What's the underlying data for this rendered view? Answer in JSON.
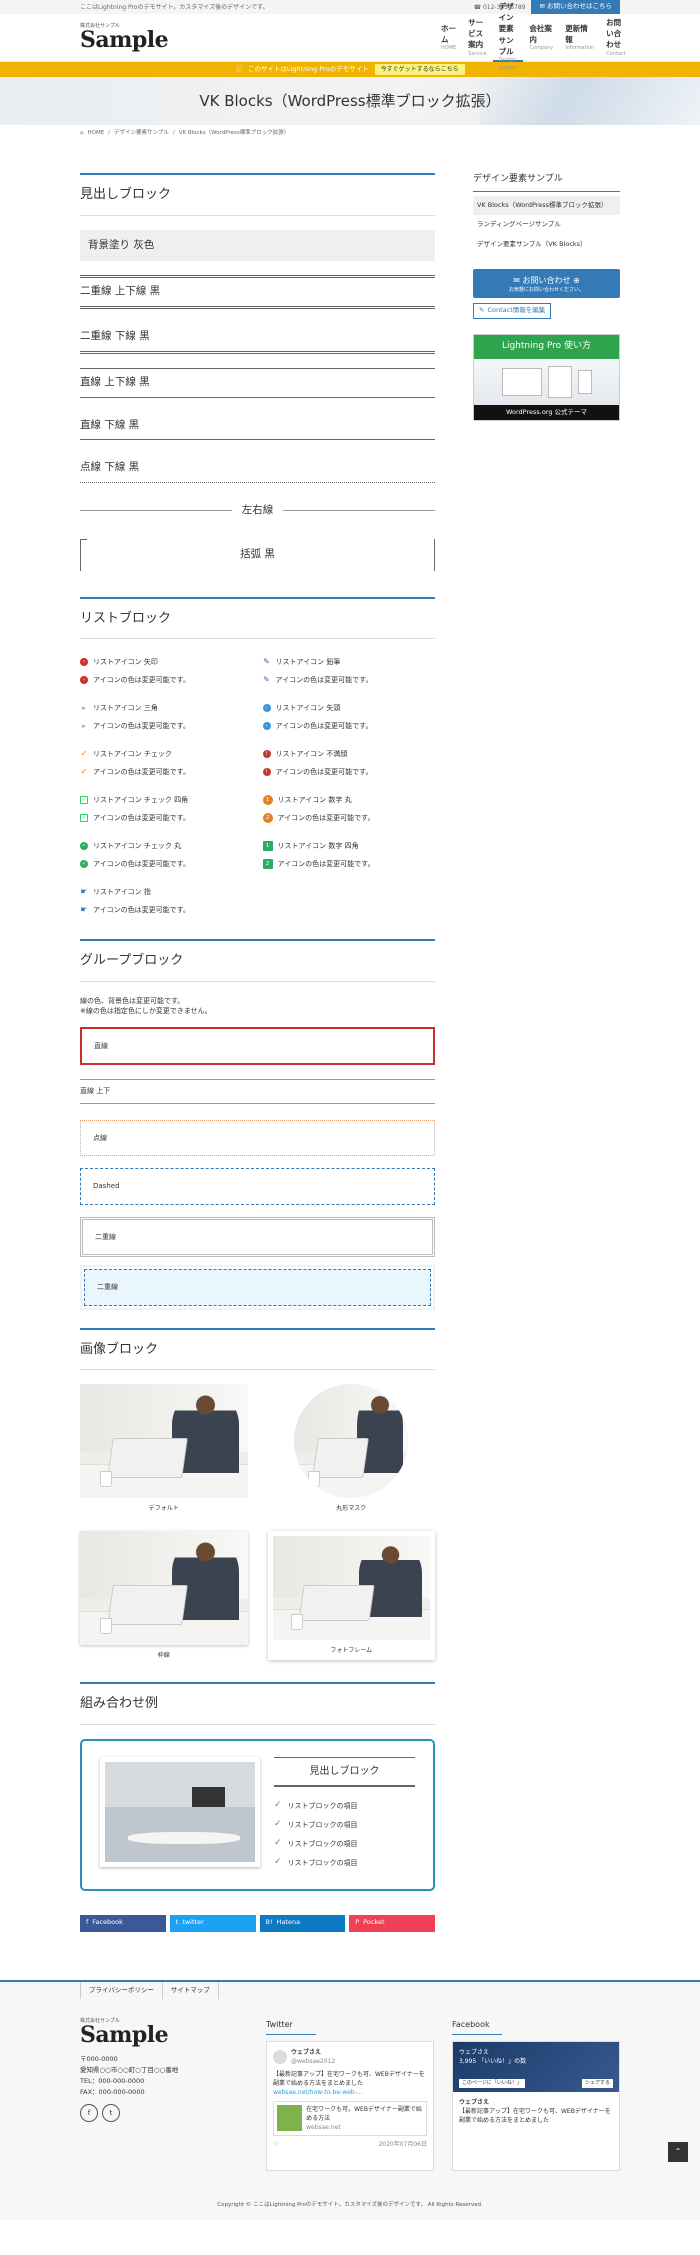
{
  "topbar": {
    "tagline": "ここはLightning Proのデモサイト。カスタマイズ後のデザインです。",
    "phone": "☎ 012-345-6789",
    "contact": "✉ お問い合わせはこちら"
  },
  "header": {
    "logo_sub": "株式会社サンプル",
    "logo_main": "Sample",
    "nav": [
      {
        "label": "ホーム",
        "en": "HOME"
      },
      {
        "label": "サービス案内",
        "en": "Service"
      },
      {
        "label": "デザイン要素サンプル",
        "en": "Design Sample"
      },
      {
        "label": "会社案内",
        "en": "Company"
      },
      {
        "label": "更新情報",
        "en": "Information"
      },
      {
        "label": "お問い合わせ",
        "en": "Contact"
      }
    ]
  },
  "notice": {
    "text": "このサイトはLightning Proのデモサイト",
    "button": "今すぐゲットするならこちら"
  },
  "page_title": "VK Blocks（WordPress標準ブロック拡張）",
  "breadcrumb": {
    "home": "HOME",
    "parent": "デザイン要素サンプル",
    "current": "VK Blocks（WordPress標準ブロック拡張）"
  },
  "headings": {
    "title": "見出しブロック",
    "items": [
      "背景塗り 灰色",
      "二重線 上下線 黒",
      "二重線 下線 黒",
      "直線 上下線 黒",
      "直線 下線 黒",
      "点線 下線 黒",
      "左右線",
      "括弧 黒"
    ]
  },
  "list_block": {
    "title": "リストブロック",
    "note": "アイコンの色は変更可能です。",
    "left": [
      {
        "label": "リストアイコン 矢印",
        "icon": "arrow-circle-icon",
        "color": "#c9302c",
        "glyph": "›"
      },
      {
        "label": "リストアイコン 三角",
        "icon": "triangle-icon",
        "color": "#999999",
        "glyph": "▸"
      },
      {
        "label": "リストアイコン チェック",
        "icon": "check-icon",
        "color": "#e67e22",
        "glyph": "✓"
      },
      {
        "label": "リストアイコン チェック 四角",
        "icon": "check-square-icon",
        "color": "#2ecc71",
        "glyph": "✓"
      },
      {
        "label": "リストアイコン チェック 丸",
        "icon": "check-circle-icon",
        "color": "#27ae60",
        "glyph": "✓"
      },
      {
        "label": "リストアイコン 指",
        "icon": "hand-point-icon",
        "color": "#337ab7",
        "glyph": "☛"
      }
    ],
    "right": [
      {
        "label": "リストアイコン 鉛筆",
        "icon": "pencil-icon",
        "color": "#8e44ad",
        "glyph": "✎"
      },
      {
        "label": "リストアイコン 矢頭",
        "icon": "arrowhead-icon",
        "color": "#3498db",
        "glyph": "›"
      },
      {
        "label": "リストアイコン 不満顔",
        "icon": "frown-icon",
        "color": "#c0392b",
        "glyph": "!"
      },
      {
        "label": "リストアイコン 数字 丸",
        "icon": "number-circle-icon",
        "color": "#e67e22",
        "glyph1": "1",
        "glyph2": "2"
      },
      {
        "label": "リストアイコン 数字 四角",
        "icon": "number-square-icon",
        "color": "#27ae60",
        "glyph1": "1",
        "glyph2": "2"
      }
    ]
  },
  "group_block": {
    "title": "グループブロック",
    "intro1": "線の色、背景色は変更可能です。",
    "intro2": "※線の色は指定色にしか変更できません。",
    "items": [
      "直線",
      "直線 上下",
      "点線",
      "Dashed",
      "二重線",
      "二重線"
    ]
  },
  "image_block": {
    "title": "画像ブロック",
    "captions": [
      "デフォルト",
      "丸形マスク",
      "枠線",
      "フォトフレーム"
    ]
  },
  "combo": {
    "title": "組み合わせ例",
    "heading": "見出しブロック",
    "items": [
      "リストブロックの項目",
      "リストブロックの項目",
      "リストブロックの項目",
      "リストブロックの項目"
    ]
  },
  "share": [
    {
      "label": "Facebook",
      "color": "#3b5998",
      "icon": "f"
    },
    {
      "label": "twitter",
      "color": "#1da1f2",
      "icon": "t"
    },
    {
      "label": "Hatena",
      "color": "#0e7ac4",
      "icon": "B!"
    },
    {
      "label": "Pocket",
      "color": "#ef4056",
      "icon": "P"
    }
  ],
  "sidebar": {
    "title": "デザイン要素サンプル",
    "links": [
      "VK Blocks（WordPress標準ブロック拡張）",
      "ランディングページサンプル",
      "デザイン要素サンプル（VK Blocks）"
    ],
    "cta_title": "✉ お問い合わせ ⊕",
    "cta_sub": "お気軽にお問い合わせください。",
    "edit": "Contact情報を編集",
    "promo_title": "Lightning Pro 使い方",
    "promo_bottom": "WordPress.org 公式テーマ"
  },
  "footer": {
    "nav": [
      "プライバシーポリシー",
      "サイトマップ"
    ],
    "logo_sub": "株式会社サンプル",
    "logo_main": "Sample",
    "address": [
      "〒000-0000",
      "愛知県○○市○○町○丁目○○番地",
      "TEL：000-000-0000",
      "FAX：000-000-0000"
    ],
    "twitter_title": "Twitter",
    "facebook_title": "Facebook",
    "tw_name": "ウェブさえ",
    "tw_handle": "@websae2012",
    "tw_text": "【最新記事アップ】在宅ワークも可、WEBデザイナーを副業で始める方法をまとめました",
    "tw_link": "websae.net/how-to-be-web-...",
    "tw_card": "在宅ワークも可。WEBデザイナー副業で始める方法",
    "tw_card_site": "websae.net",
    "tw_date": "2020年07月06日",
    "fb_name": "ウェブさえ",
    "fb_likes": "3,995 「いいね！」の数",
    "fb_page": "このページに「いいね！」",
    "fb_share": "シェアする",
    "fb_text": "【最新記事アップ】在宅ワークも可、WEBデザイナーを副業で始める方法をまとめました",
    "copyright": "Copyright © ここはLightning Proのデモサイト。カスタマイズ後のデザインです。 All Rights Reserved."
  }
}
